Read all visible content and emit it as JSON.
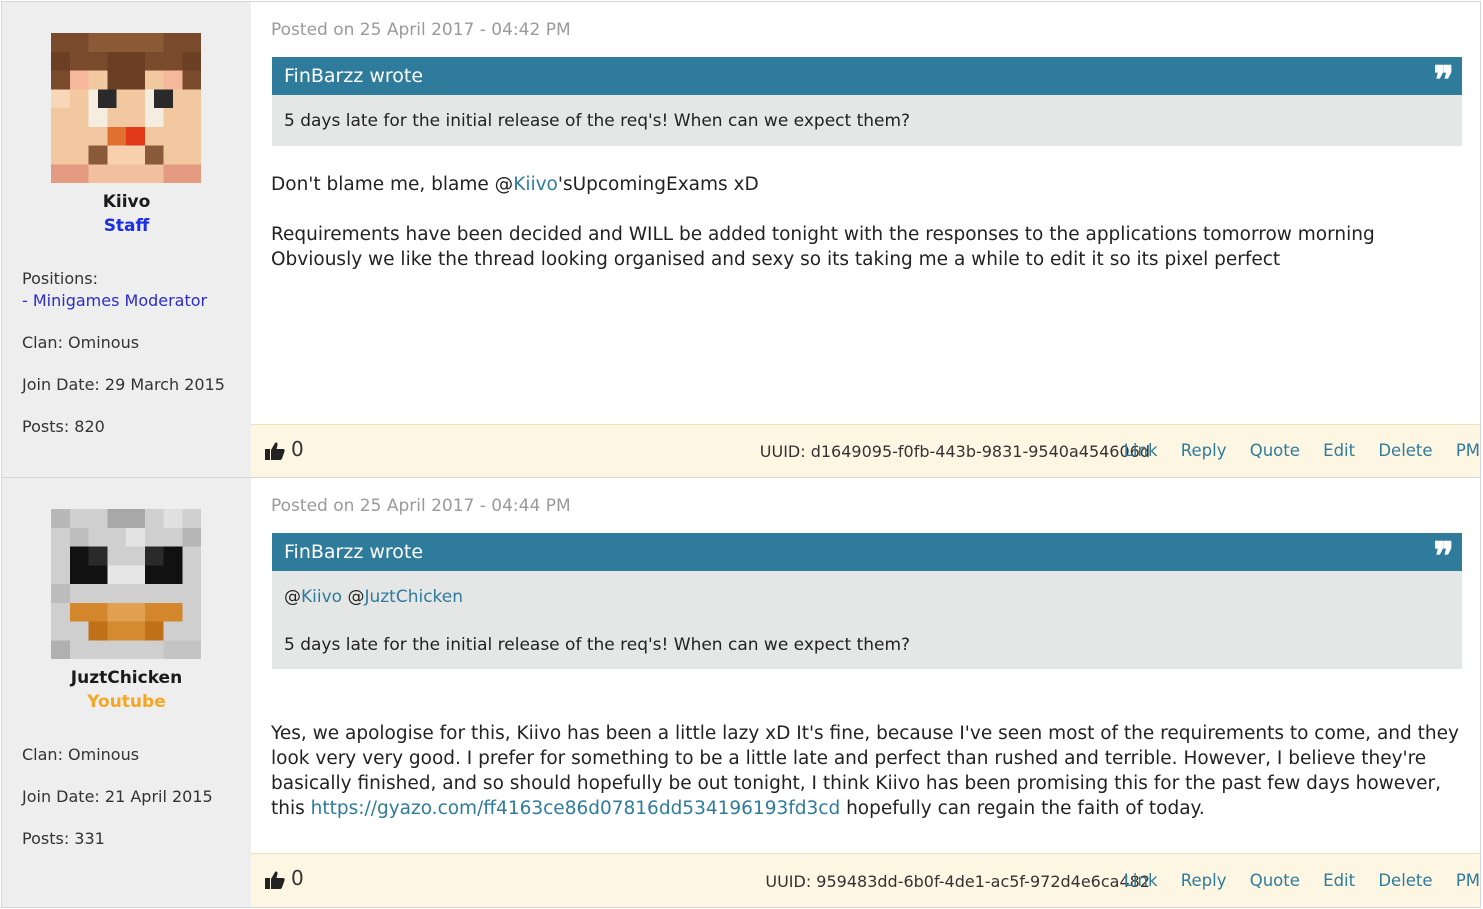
{
  "posts": [
    {
      "author": {
        "name": "Kiivo",
        "rank": "Staff",
        "rank_color": "#1a2ee6",
        "positions_label": "Positions:",
        "position": "- Minigames Moderator",
        "clan": "Clan: Ominous",
        "join_date": "Join Date: 29 March 2015",
        "posts": "Posts: 820",
        "avatar_icon": "steve-face-avatar"
      },
      "posted": "Posted on 25 April 2017 - 04:42 PM",
      "quote": {
        "header": "FinBarzz wrote",
        "text": "5 days late for the initial release of the req's! When can we expect them?"
      },
      "body": {
        "line1_pre": "Don't blame me, blame @",
        "mention": "Kiivo",
        "line1_post": "'sUpcomingExams xD",
        "line2": "Requirements have been decided and WILL be added tonight with the responses to the applications tomorrow morning",
        "line3": "Obviously we like the thread looking organised and sexy so its taking me a while to edit it so its pixel perfect"
      },
      "likes": "0",
      "uuid": "UUID: d1649095-f0fb-443b-9831-9540a454606d"
    },
    {
      "author": {
        "name": "JuztChicken",
        "rank": "Youtube",
        "rank_color": "#f5a623",
        "clan": "Clan: Ominous",
        "join_date": "Join Date: 21 April 2015",
        "posts": "Posts: 331",
        "avatar_icon": "chicken-face-avatar"
      },
      "posted": "Posted on 25 April 2017 - 04:44 PM",
      "quote": {
        "header": "FinBarzz wrote",
        "mention1_at": "@",
        "mention1": "Kiivo",
        "mention2_at": "@",
        "mention2": "JuztChicken",
        "text": "5 days late for the initial release of the req's! When can we expect them?"
      },
      "body": {
        "text_pre": "Yes, we apologise for this, Kiivo has been a little lazy xD It's fine, because I've seen most of the requirements to come, and they look very very good. I prefer for something to be a little late and perfect than rushed and terrible. However, I believe they're basically finished, and so should hopefully be out tonight, I think Kiivo has been promising this for the past few days however, this ",
        "link": "https://gyazo.com/ff4163ce86d07816dd534196193fd3cd",
        "text_post": " hopefully can regain the faith of today."
      },
      "likes": "0",
      "uuid": "UUID: 959483dd-6b0f-4de1-ac5f-972d4e6ca482"
    }
  ],
  "actions": {
    "link": "Link",
    "reply": "Reply",
    "quote": "Quote",
    "edit": "Edit",
    "delete": "Delete",
    "pm": "PM"
  },
  "icons": {
    "like": "thumbs-up-icon",
    "quote": "quote-icon"
  }
}
